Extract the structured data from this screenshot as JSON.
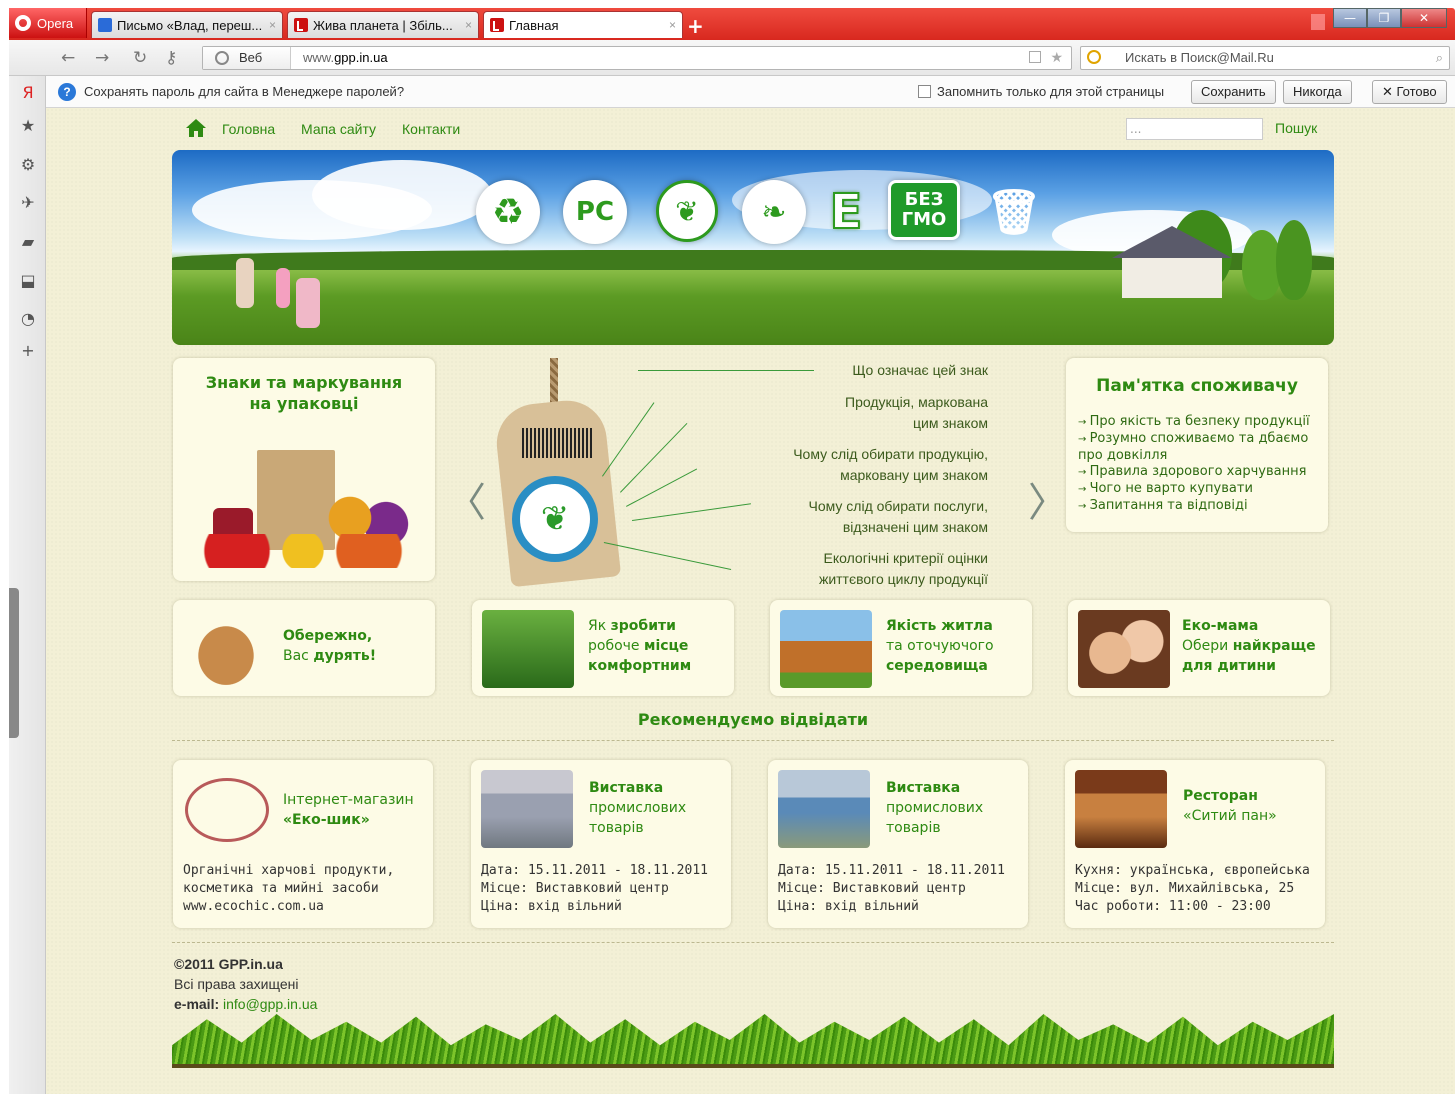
{
  "browser": {
    "opera_label": "Opera",
    "tabs": [
      {
        "title": "Письмо «Влад, переш...",
        "close": "×"
      },
      {
        "title": "Жива планета | Збіль...",
        "close": "×"
      },
      {
        "title": "Главная",
        "close": "×"
      }
    ],
    "new_tab": "+",
    "address": {
      "mode": "Веб",
      "url_prefix": "www.",
      "url_domain": "gpp.in.ua"
    },
    "search_placeholder": "Искать в Поиск@Mail.Ru"
  },
  "password_bar": {
    "message": "Сохранять пароль для сайта в Менеджере паролей?",
    "checkbox_label": "Запомнить только для этой страницы",
    "save": "Сохранить",
    "never": "Никогда",
    "done": "✕ Готово"
  },
  "site": {
    "nav": [
      "Головна",
      "Мапа сайту",
      "Контакти"
    ],
    "search_value": "...",
    "search_button": "Пошук",
    "banner_icons": [
      "recycle-icon",
      "rst-icon",
      "eco-cert-icon",
      "leaf-icon",
      "e-mark-icon",
      "no-gmo-icon",
      "bin-icon"
    ],
    "banner_text": {
      "e": "E",
      "gmo_1": "БЕЗ",
      "gmo_2": "ГМО",
      "rst": "PC"
    },
    "signs_card": {
      "title_1": "Знаки та маркування",
      "title_2": "на упаковці"
    },
    "tag_questions": [
      [
        "Що означає цей знак"
      ],
      [
        "Продукція, маркована",
        "цим знаком"
      ],
      [
        "Чому слід обирати продукцію,",
        "марковану цим знаком"
      ],
      [
        "Чому слід обирати послуги,",
        "відзначені цим знаком"
      ],
      [
        "Екологічні критерії оцінки",
        "життєвого циклу продукції"
      ]
    ],
    "arrows": {
      "left": "〈",
      "right": "〉"
    },
    "memo": {
      "title": "Пам'ятка споживачу",
      "items": [
        "Про якість та безпеку продукції",
        "Розумно споживаємо та дбаємо про довкілля",
        "Правила здорового харчування",
        "Чого не варто купувати",
        "Запитання та відповіді"
      ]
    },
    "promo": [
      {
        "l1a": "Обережно,",
        "l2a": "Вас ",
        "l2b": "дурять!"
      },
      {
        "l1a": "Як ",
        "l1b": "зробити",
        "l2a": "робоче ",
        "l2b": "місце",
        "l3b": "комфортним"
      },
      {
        "l1b": "Якість житла",
        "l2a": "та оточуючого",
        "l3b": "середовища"
      },
      {
        "l1b": "Еко-мама",
        "l2a": "Обери ",
        "l2b": "найкраще",
        "l3b": "для дитини"
      }
    ],
    "recommend_title": "Рекомендуємо відвідати",
    "recommend": [
      {
        "title_1": "Інтернет-магазин",
        "title_2": "«Еко-шик»",
        "info": [
          "Органічні харчові продукти,",
          "косметика та мийні засоби",
          "www.ecochic.com.ua"
        ]
      },
      {
        "title_1": "Виставка",
        "title_2": "промислових",
        "title_3": "товарів",
        "info": [
          "Дата: 15.11.2011 - 18.11.2011",
          "Місце: Виставковий центр",
          "Ціна: вхід вільний"
        ]
      },
      {
        "title_1": "Виставка",
        "title_2": "промислових",
        "title_3": "товарів",
        "info": [
          "Дата: 15.11.2011 - 18.11.2011",
          "Місце: Виставковий центр",
          "Ціна: вхід вільний"
        ]
      },
      {
        "title_1": "Ресторан",
        "title_2": "«Ситий пан»",
        "info": [
          "Кухня: українська, європейська",
          "Місце: вул. Михайлівська, 25",
          "Час роботи: 11:00 - 23:00"
        ]
      }
    ],
    "footer": {
      "copyright": "©2011 GPP.in.ua",
      "rights": "Всі права захищені",
      "email_label": "e-mail:",
      "email": "info@gpp.in.ua"
    }
  },
  "colors": {
    "green": "#2e8a12",
    "page_bg": "#f3f0d6",
    "card_bg": "#fdfbe6",
    "opera_red": "#d8281f"
  }
}
